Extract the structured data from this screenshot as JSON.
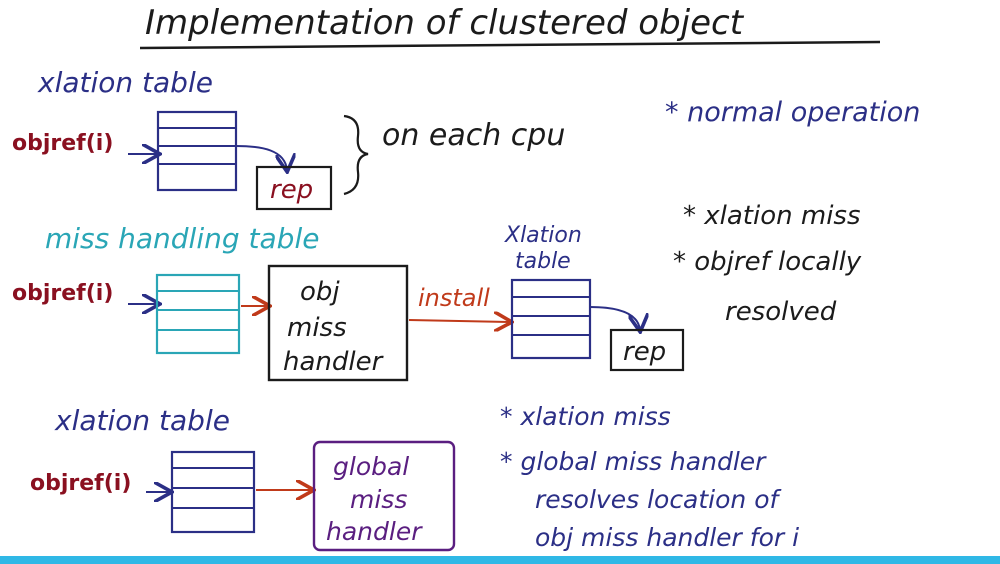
{
  "title": "Implementation of clustered object",
  "colors": {
    "ink": "#1b1b1b",
    "navy": "#2b2f86",
    "red": "#8a1020",
    "teal": "#2aa6b6",
    "purple": "#5a1e80",
    "arrow_red": "#c03a1a",
    "bar": "#2fb8e6"
  },
  "section1": {
    "table_label": "xlation table",
    "objref": "objref(i)",
    "rep": "rep",
    "brace_note": "on each cpu",
    "note": "* normal operation"
  },
  "section2": {
    "table_label": "miss handling table",
    "objref": "objref(i)",
    "handler": [
      "obj",
      "miss",
      "handler"
    ],
    "install": "install",
    "xlation_label": [
      "Xlation",
      "table"
    ],
    "rep": "rep",
    "notes": [
      "* xlation miss",
      "* objref locally",
      "resolved"
    ]
  },
  "section3": {
    "table_label": "xlation table",
    "objref": "objref(i)",
    "handler": [
      "global",
      "miss",
      "handler"
    ],
    "notes": [
      "* xlation miss",
      "* global miss handler",
      "resolves location of",
      "obj miss handler for i"
    ]
  }
}
